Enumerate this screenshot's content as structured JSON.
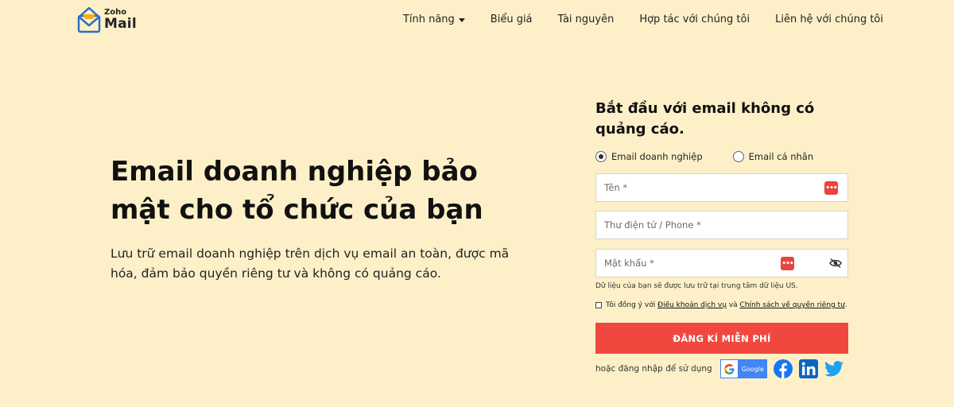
{
  "brand": {
    "zoho": "Zoho",
    "mail": "Mail"
  },
  "nav": {
    "features": "Tính năng",
    "pricing": "Biểu giá",
    "resources": "Tài nguyên",
    "partner": "Hợp tác với chúng tôi",
    "contact": "Liên hệ với chúng tôi"
  },
  "hero": {
    "title": "Email doanh nghiệp bảo mật cho tổ chức của bạn",
    "description": "Lưu trữ email doanh nghiệp trên dịch vụ email an toàn, được mã hóa, đảm bảo quyền riêng tư và không có quảng cáo."
  },
  "form": {
    "title": "Bắt đầu với email không có quảng cáo.",
    "radio_business": "Email doanh nghiệp",
    "radio_personal": "Email cá nhân",
    "name_placeholder": "Tên *",
    "email_placeholder": "Thư điện tử / Phone *",
    "password_placeholder": "Mật khẩu *",
    "data_note": "Dữ liệu của bạn sẽ được lưu trữ tại trung tâm dữ liệu US.",
    "agree_prefix": "Tôi đồng ý với",
    "terms_link": "Điều khoản dịch vụ",
    "agree_and": "và",
    "privacy_link": "Chính sách về quyền riêng tư",
    "agree_suffix": ".",
    "signup_button": "ĐĂNG KÍ MIỄN PHÍ",
    "social_label": "hoặc đăng nhập để sử dụng",
    "google_label": "Google"
  },
  "colors": {
    "background": "#fdf0c8",
    "accent": "#f0483e",
    "google": "#4285f4",
    "facebook": "#1877f2",
    "linkedin": "#0a66c2",
    "twitter": "#1da1f2"
  }
}
